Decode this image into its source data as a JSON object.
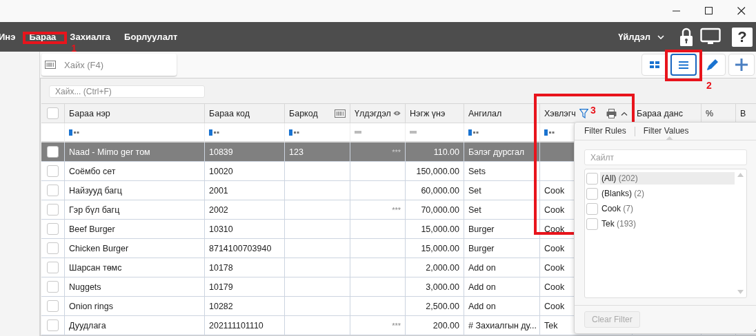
{
  "nav": {
    "items": [
      {
        "label": "Инэ"
      },
      {
        "label": "Бараа",
        "annotation": "1"
      },
      {
        "label": "Захиалга"
      },
      {
        "label": "Борлуулалт"
      }
    ],
    "action_menu": "Үйлдэл",
    "help_glyph": "?"
  },
  "search": {
    "placeholder": "Хайх (F4)"
  },
  "view_buttons": [
    {
      "kind": "grid",
      "selected": false
    },
    {
      "kind": "list",
      "selected": true,
      "annotation": "2"
    }
  ],
  "action_buttons": [
    {
      "kind": "edit"
    },
    {
      "kind": "add"
    }
  ],
  "grid_search": {
    "placeholder": "Хайх... (Ctrl+F)"
  },
  "table": {
    "select_all": {
      "checked": false
    },
    "columns": [
      {
        "title": "Бараа нэр",
        "kind": "text"
      },
      {
        "title": "Бараа код",
        "kind": "text"
      },
      {
        "title": "Баркод",
        "kind": "barcode"
      },
      {
        "title": "Үлдэгдэл",
        "kind": "stock"
      },
      {
        "title": "Нэгж үнэ",
        "kind": "number"
      },
      {
        "title": "Ангилал",
        "kind": "text"
      },
      {
        "title": "Хэвлэгч",
        "kind": "printer",
        "annotation": "3"
      },
      {
        "title": "Бараа данс",
        "kind": "plain"
      },
      {
        "title": "%",
        "kind": "plain"
      },
      {
        "title": "В",
        "kind": "plain"
      }
    ],
    "rows": [
      {
        "selected": true,
        "checked": false,
        "cells": [
          "Naad - Mimo ger том",
          "10839",
          "123",
          "***",
          "110.00",
          "Бэлэг дурсгал",
          ""
        ]
      },
      {
        "selected": false,
        "checked": false,
        "cells": [
          "Соёмбо сет",
          "10020",
          "",
          "",
          "150,000.00",
          "Sets",
          ""
        ]
      },
      {
        "selected": false,
        "checked": false,
        "cells": [
          "Найзууд багц",
          "2001",
          "",
          "",
          "60,000.00",
          "Set",
          "Cook"
        ]
      },
      {
        "selected": false,
        "checked": false,
        "cells": [
          "Гэр бүл багц",
          "2002",
          "",
          "***",
          "70,000.00",
          "Set",
          "Cook"
        ]
      },
      {
        "selected": false,
        "checked": false,
        "cells": [
          "Beef Burger",
          "10310",
          "",
          "",
          "15,000.00",
          "Burger",
          "Cook"
        ]
      },
      {
        "selected": false,
        "checked": false,
        "cells": [
          "Chicken Burger",
          "8714100703940",
          "",
          "",
          "15,000.00",
          "Burger",
          "Cook"
        ]
      },
      {
        "selected": false,
        "checked": false,
        "cells": [
          "Шарсан төмс",
          "10178",
          "",
          "",
          "2,000.00",
          "Add on",
          "Cook"
        ]
      },
      {
        "selected": false,
        "checked": false,
        "cells": [
          "Nuggets",
          "10179",
          "",
          "",
          "3,000.00",
          "Add on",
          "Cook"
        ]
      },
      {
        "selected": false,
        "checked": false,
        "cells": [
          "Onion rings",
          "10282",
          "",
          "",
          "2,500.00",
          "Add on",
          "Cook"
        ]
      },
      {
        "selected": false,
        "checked": false,
        "cells": [
          "Дуудлага",
          "202111101110",
          "",
          "***",
          "200.00",
          "# Захиалгын ду...",
          "Tek"
        ]
      }
    ]
  },
  "filter_popup": {
    "tabs": [
      {
        "label": "Filter Rules",
        "selected": false
      },
      {
        "label": "Filter Values",
        "selected": true
      }
    ],
    "search_placeholder": "Хайлт",
    "values": [
      {
        "label": "(All)",
        "count": "(202)",
        "checked": false,
        "highlighted": true
      },
      {
        "label": "(Blanks)",
        "count": "(2)",
        "checked": false,
        "highlighted": false
      },
      {
        "label": "Cook",
        "count": "(7)",
        "checked": false,
        "highlighted": false
      },
      {
        "label": "Tek",
        "count": "(193)",
        "checked": false,
        "highlighted": false
      }
    ],
    "clear_button": {
      "label": "Clear Filter",
      "disabled": true
    }
  }
}
